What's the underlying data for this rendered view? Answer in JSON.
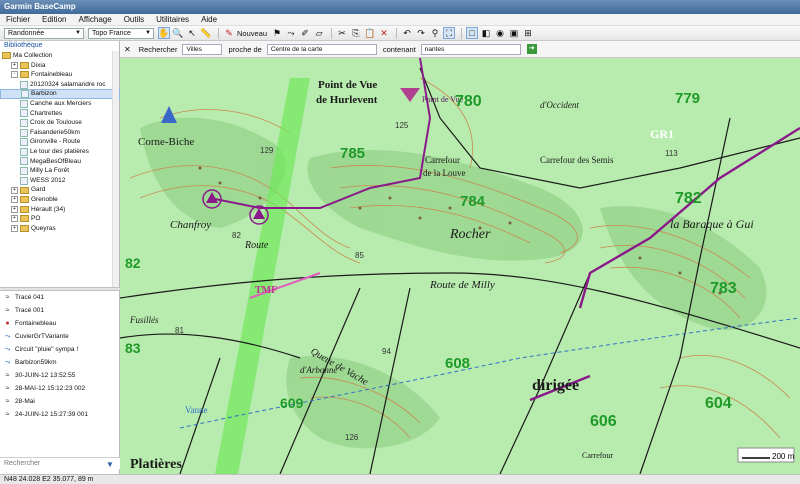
{
  "window": {
    "title": "Garmin BaseCamp"
  },
  "menu": [
    "Fichier",
    "Edition",
    "Affichage",
    "Outils",
    "Utilitaires",
    "Aide"
  ],
  "toolbar": {
    "activity": "Randonnée",
    "map_product": "Topo France",
    "new_label": "Nouveau"
  },
  "sidebar": {
    "library_label": "Bibliothèque",
    "tree": [
      {
        "label": "Ma Collection",
        "level": 0,
        "type": "root"
      },
      {
        "label": "Dixia",
        "level": 1,
        "type": "folder",
        "expander": "+"
      },
      {
        "label": "Fontainebleau",
        "level": 1,
        "type": "folder",
        "expander": "-"
      },
      {
        "label": "20120324 salamandre roc",
        "level": 2,
        "type": "list"
      },
      {
        "label": "Barbizon",
        "level": 2,
        "type": "list",
        "selected": true
      },
      {
        "label": "Canche aux Merciers",
        "level": 2,
        "type": "list"
      },
      {
        "label": "Chartrettes",
        "level": 2,
        "type": "list"
      },
      {
        "label": "Croix de Toulouse",
        "level": 2,
        "type": "list"
      },
      {
        "label": "Faisanderie50km",
        "level": 2,
        "type": "list"
      },
      {
        "label": "Gironville - Route",
        "level": 2,
        "type": "list"
      },
      {
        "label": "Le tour des platières",
        "level": 2,
        "type": "list"
      },
      {
        "label": "MegaBesOfBleau",
        "level": 2,
        "type": "list"
      },
      {
        "label": "Milly La Forêt",
        "level": 2,
        "type": "list"
      },
      {
        "label": "WESS 2012",
        "level": 2,
        "type": "list"
      },
      {
        "label": "Gard",
        "level": 1,
        "type": "folder",
        "expander": "+"
      },
      {
        "label": "Grenoble",
        "level": 1,
        "type": "folder",
        "expander": "+"
      },
      {
        "label": "Hérault (34)",
        "level": 1,
        "type": "folder",
        "expander": "+"
      },
      {
        "label": "PO",
        "level": 1,
        "type": "folder",
        "expander": "+"
      },
      {
        "label": "Queyras",
        "level": 1,
        "type": "folder",
        "expander": "+"
      }
    ],
    "items": [
      {
        "label": "Tracé 041",
        "icon": "track-icon"
      },
      {
        "label": "Tracé 001",
        "icon": "track-icon"
      },
      {
        "label": "Fontainebleau",
        "icon": "waypoint-icon"
      },
      {
        "label": "CuvierGrTVariante",
        "icon": "route-icon"
      },
      {
        "label": "Circuit \"pluie\" sympa !",
        "icon": "route-icon"
      },
      {
        "label": "Barbizon59km",
        "icon": "route-icon"
      },
      {
        "label": "30-JUIN-12 13:52:55",
        "icon": "track-icon"
      },
      {
        "label": "28-MAI-12 15:12:23 002",
        "icon": "track-icon"
      },
      {
        "label": "28-Mai",
        "icon": "track-icon"
      },
      {
        "label": "24-JUIN-12 15:27:39 001",
        "icon": "track-icon"
      }
    ],
    "search_placeholder": "Rechercher"
  },
  "findbar": {
    "search_label": "Rechercher",
    "category": "Villes",
    "near_label": "proche de",
    "near_value": "Centre de la carte",
    "containing_label": "contenant",
    "containing_value": "nantes"
  },
  "map": {
    "labels": {
      "point_de_vue": "Point de Vue",
      "point_de_vue_hurlevent": "Point de Vue",
      "hurlevent": "de Hurlevent",
      "corne_biche": "Corne-Biche",
      "carrefour_louve": "Carrefour",
      "de_la_louve": "de la Louve",
      "carrefour_semis": "Carrefour des Semis",
      "rocher": "Rocher",
      "route_milly": "Route   de    Milly",
      "chanfroy": "Chanfroy",
      "route": "Route",
      "baraque": "la Baraque à Gui",
      "dirigee": "dirigée",
      "platieres": "Platières",
      "queue_vache": "Queue de Vache",
      "arbonne": "d'Arbonne",
      "occident": "d'Occident",
      "tmf": "TMF",
      "grt": "GR1",
      "carrefour_bottom": "Carrefour",
      "fusilles": "Fusillés",
      "vanne": "Vanne",
      "scale": "200 m"
    },
    "parcels": [
      "780",
      "785",
      "784",
      "782",
      "783",
      "82",
      "83",
      "608",
      "606",
      "609",
      "604",
      "779"
    ],
    "spots": [
      "125",
      "113",
      "129",
      "82",
      "85",
      "81",
      "94",
      "126"
    ]
  },
  "status": {
    "coords": "N48 24.028 E2 35.077, 89 m"
  },
  "colors": {
    "map_bg": "#b8ecae",
    "purple_route": "#8a1a8a",
    "parcel_green": "#1f9a28",
    "road": "#1a1a1a"
  }
}
